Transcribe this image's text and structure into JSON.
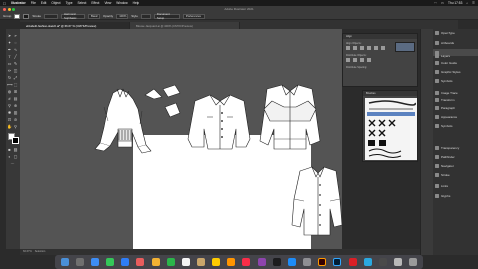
{
  "menubar": {
    "apple": "",
    "app_name": "Illustrator",
    "items": [
      "File",
      "Edit",
      "Object",
      "Type",
      "Select",
      "Effect",
      "View",
      "Window",
      "Help"
    ],
    "clock": "Thu 17:53"
  },
  "window": {
    "title": "Adobe Illustrator 2021"
  },
  "control": {
    "selection_label": "Group",
    "stroke_label": "Stroke",
    "brush_value": "Harmonic Sqrt/basic",
    "style_value": "Basic",
    "opacity_label": "Opacity",
    "opacity_value": "100%",
    "style_label": "Style",
    "doc_setup": "Document Setup",
    "preferences": "Preferences"
  },
  "tabs": [
    {
      "label": "elizabeth-fashion-sketch.ai* @ 66.67 % (CMYK/Preview)",
      "active": true
    },
    {
      "label": "Blouse Jacquard.ai @ 400% (CMYK/Preview)",
      "active": false
    }
  ],
  "align_panel": {
    "title": "Align",
    "sections": [
      "Align Objects:",
      "Distribute Objects:",
      "Distribute Spacing:"
    ]
  },
  "brushes_panel": {
    "title": "Brushes"
  },
  "dock": {
    "items": [
      {
        "label": "OpenType",
        "icon": "opentype-icon"
      },
      {
        "label": "Artboards",
        "icon": "artboards-icon"
      },
      {
        "label": "",
        "icon": "blank-icon"
      },
      {
        "label": "Layers",
        "icon": "layers-icon"
      },
      {
        "label": "Color Guide",
        "icon": "color-guide-icon"
      },
      {
        "label": "Graphic Styles",
        "icon": "graphic-styles-icon"
      },
      {
        "label": "Symbols",
        "icon": "symbols-icon"
      },
      {
        "label": "Image Trace",
        "icon": "image-trace-icon"
      },
      {
        "label": "Transform",
        "icon": "transform-icon"
      },
      {
        "label": "Paragraph",
        "icon": "paragraph-icon"
      },
      {
        "label": "Appearance",
        "icon": "appearance-icon"
      },
      {
        "label": "Symbols",
        "icon": "symbols-icon"
      },
      {
        "label": "Transparency",
        "icon": "transparency-icon"
      },
      {
        "label": "Pathfinder",
        "icon": "pathfinder-icon"
      },
      {
        "label": "Navigator",
        "icon": "navigator-icon"
      },
      {
        "label": "Stroke",
        "icon": "stroke-icon"
      },
      {
        "label": "Links",
        "icon": "links-icon"
      },
      {
        "label": "Glyphs",
        "icon": "glyphs-icon"
      }
    ]
  },
  "status_bar": {
    "zoom": "66.67%",
    "tool": "Selection"
  },
  "colors": {
    "canvas": "#545454",
    "artboard": "#ffffff",
    "panel": "#434343",
    "ui_dark": "#2b2b2b"
  }
}
